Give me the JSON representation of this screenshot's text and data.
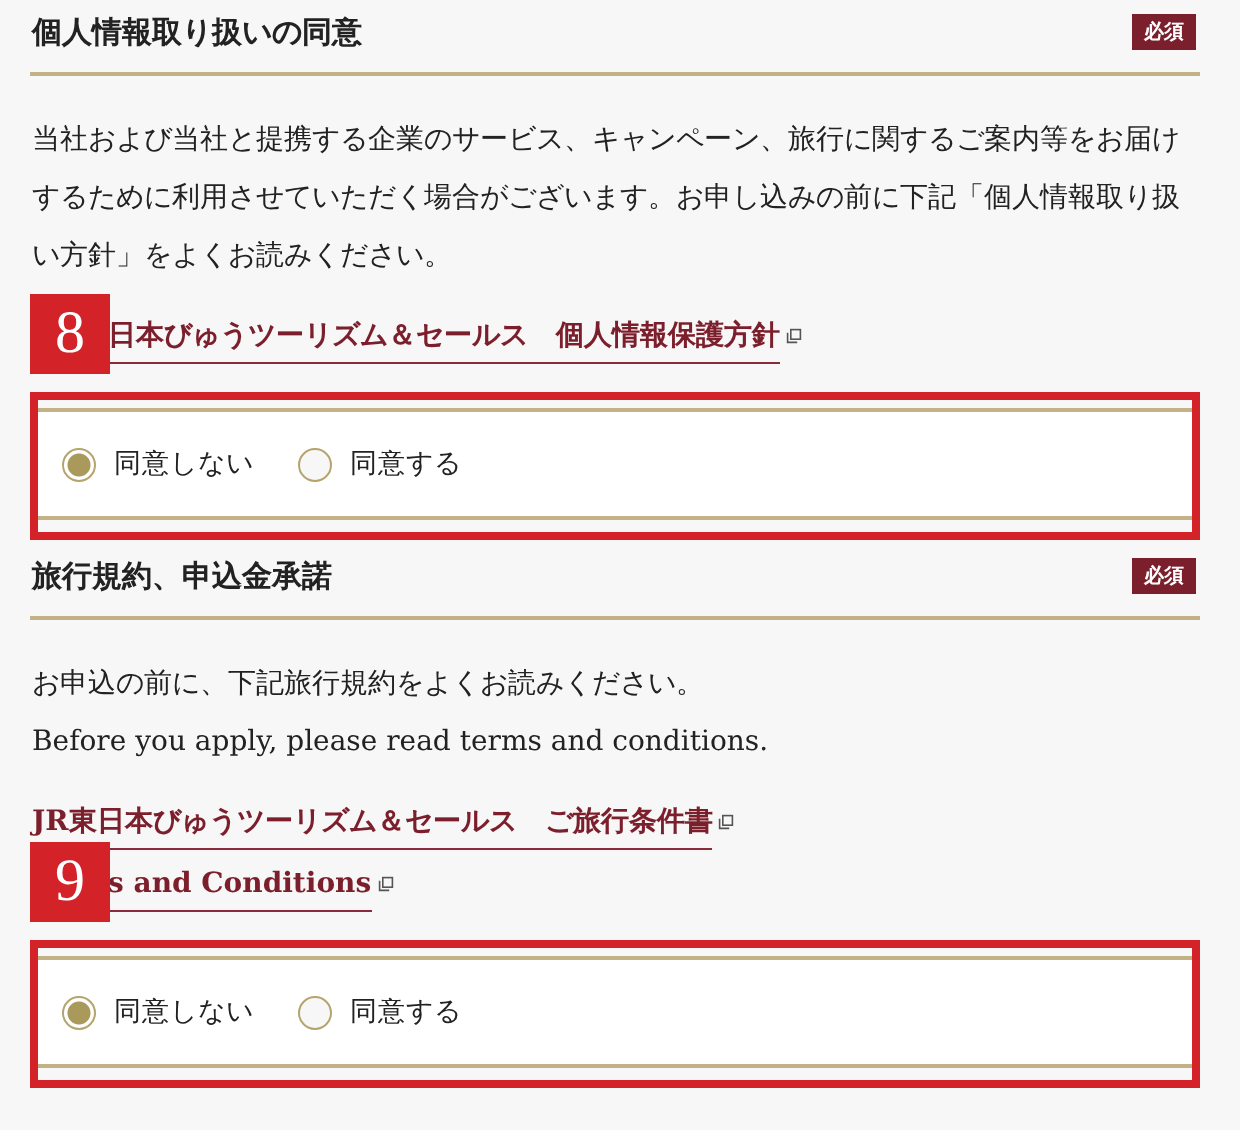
{
  "sections": [
    {
      "title": "個人情報取り扱いの同意",
      "badge": "必須",
      "paragraphs": [
        "当社および当社と提携する企業のサービス、キャンペーン、旅行に関するご案内等をお届けするために利用させていただく場合がございます。お申し込みの前に下記「個人情報取り扱い方針」をよくお読みください。"
      ],
      "links": [
        {
          "text": "日本びゅうツーリズム＆セールス　個人情報保護方針",
          "marker": "8"
        }
      ],
      "options": [
        {
          "label": "同意しない",
          "selected": true
        },
        {
          "label": "同意する",
          "selected": false
        }
      ]
    },
    {
      "title": "旅行規約、申込金承諾",
      "badge": "必須",
      "paragraphs": [
        "お申込の前に、下記旅行規約をよくお読みください。",
        "Before you apply, please read terms and conditions."
      ],
      "links": [
        {
          "text": "JR東日本びゅうツーリズム＆セールス　ご旅行条件書"
        },
        {
          "text": "s and Conditions",
          "marker": "9"
        }
      ],
      "options": [
        {
          "label": "同意しない",
          "selected": true
        },
        {
          "label": "同意する",
          "selected": false
        }
      ]
    }
  ]
}
